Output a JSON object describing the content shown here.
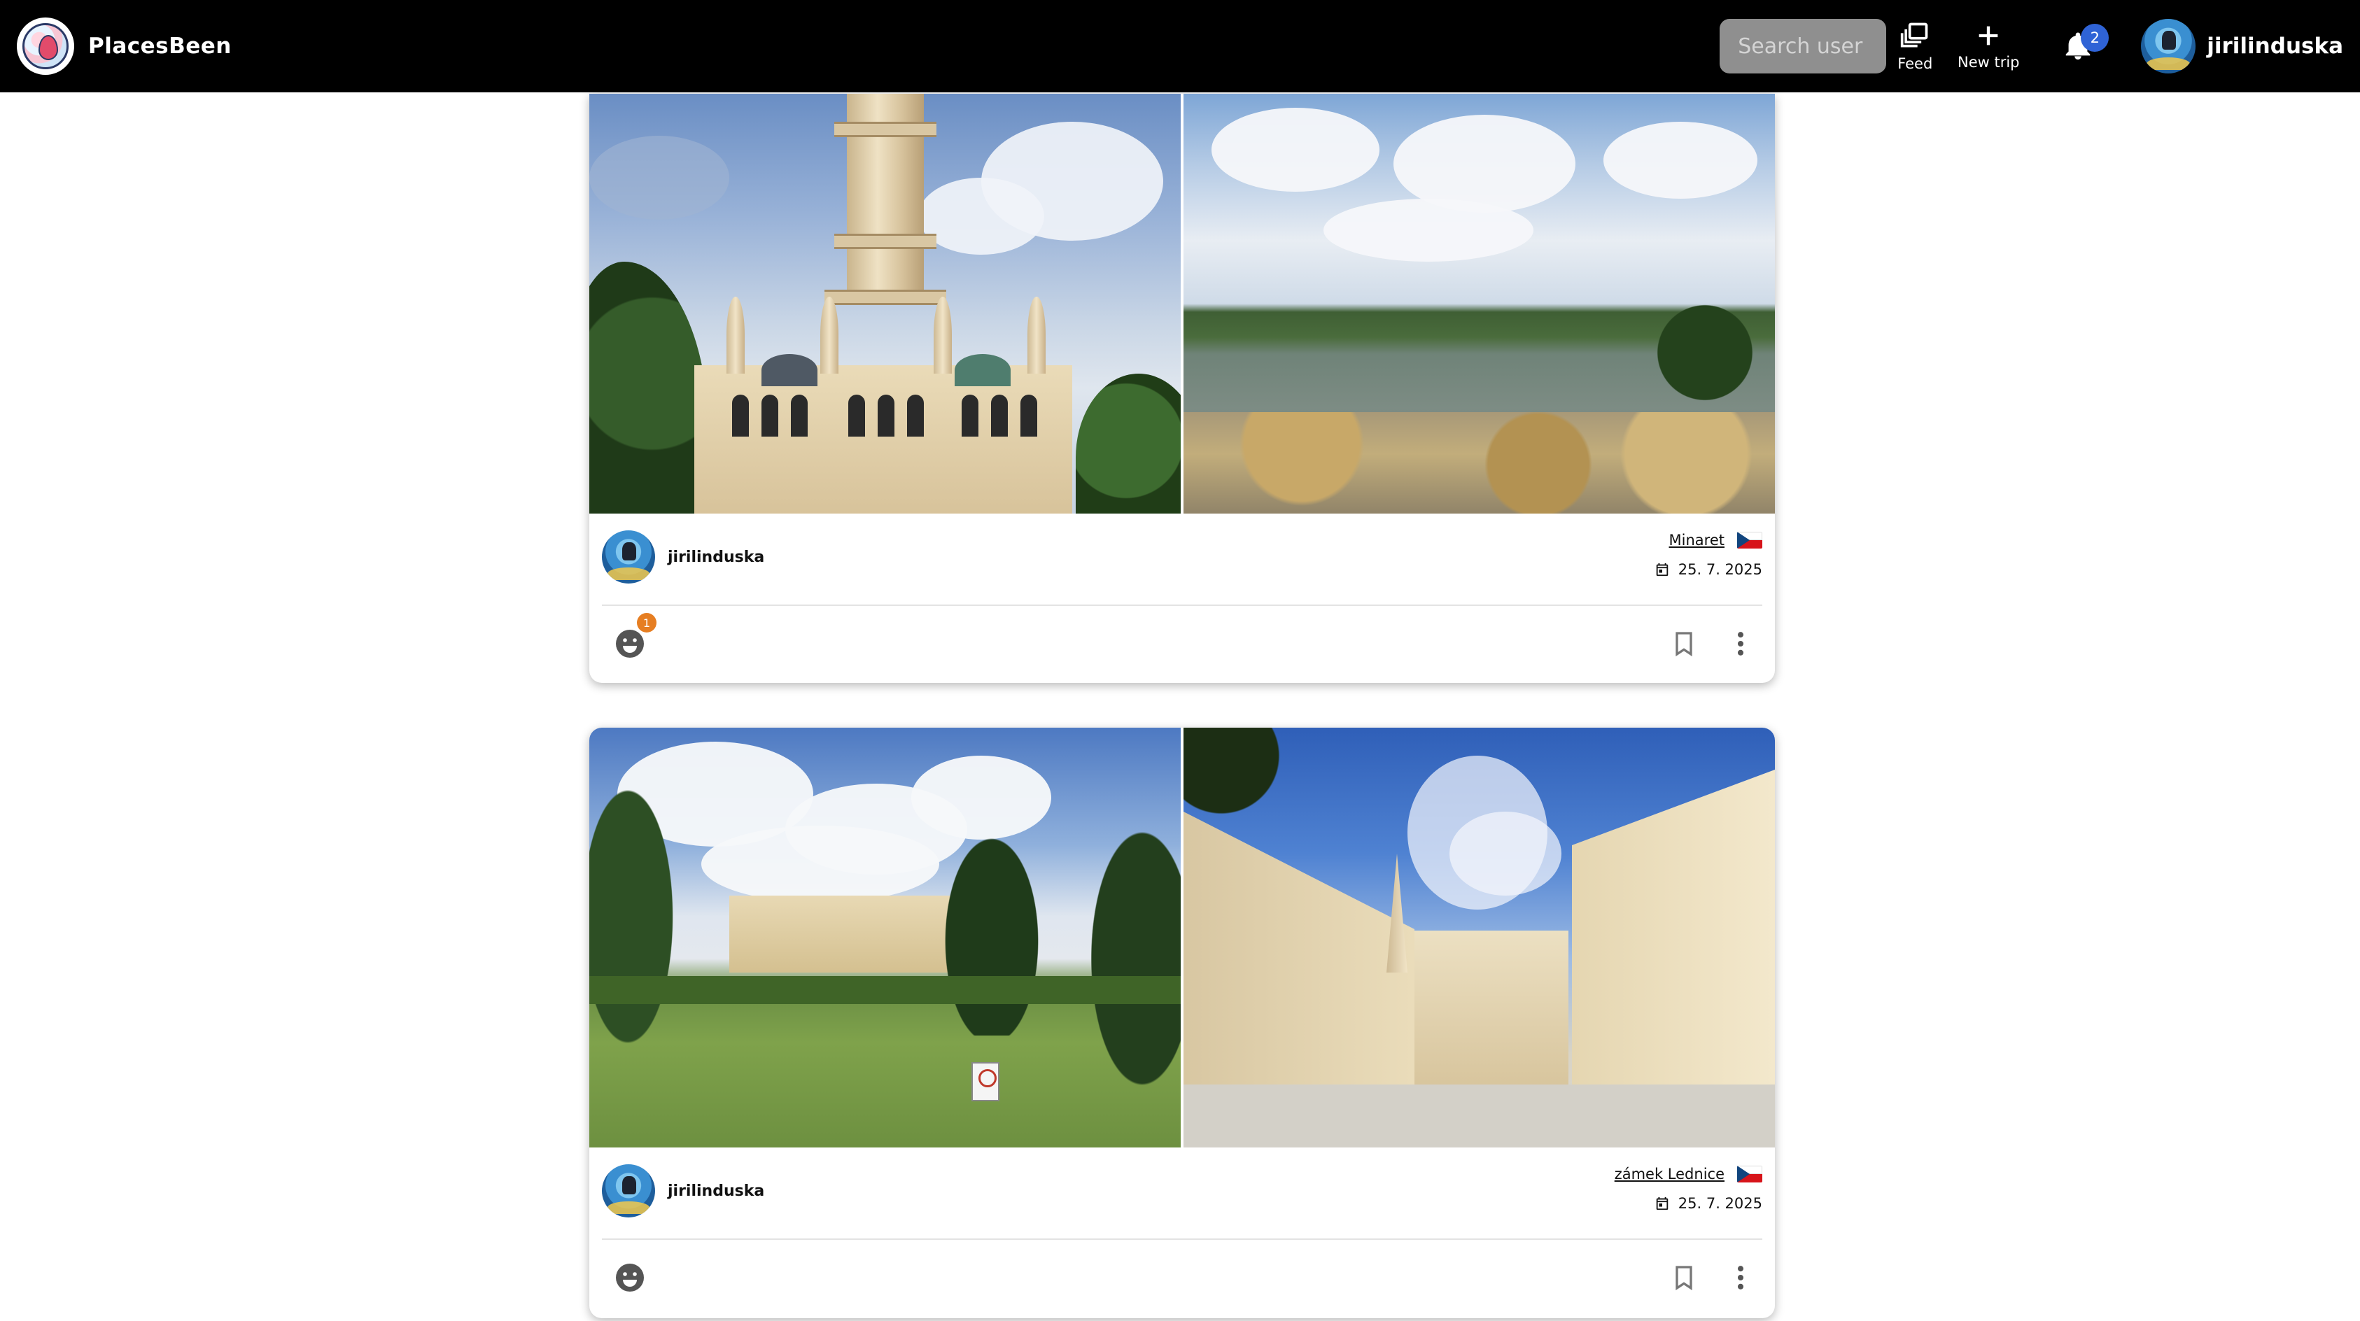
{
  "app": {
    "name": "PlacesBeen"
  },
  "header": {
    "search_placeholder": "Search user",
    "nav": {
      "feed_label": "Feed",
      "new_trip_label": "New trip"
    },
    "notifications_count": "2",
    "username": "jirilinduska"
  },
  "posts": [
    {
      "author": "jirilinduska",
      "place": "Minaret",
      "country_flag": "czech-flag",
      "date": "25. 7. 2025",
      "reaction_count": "1",
      "photos": [
        "minaret-tower-photo",
        "lednice-lake-view-photo"
      ]
    },
    {
      "author": "jirilinduska",
      "place": "zámek Lednice",
      "country_flag": "czech-flag",
      "date": "25. 7. 2025",
      "reaction_count": "",
      "photos": [
        "chateau-garden-photo",
        "chateau-courtyard-photo"
      ]
    }
  ],
  "colors": {
    "topbar": "#000000",
    "search_bg": "#8f8f8f",
    "notification_badge": "#2f63d6",
    "reaction_badge": "#e67e22"
  }
}
